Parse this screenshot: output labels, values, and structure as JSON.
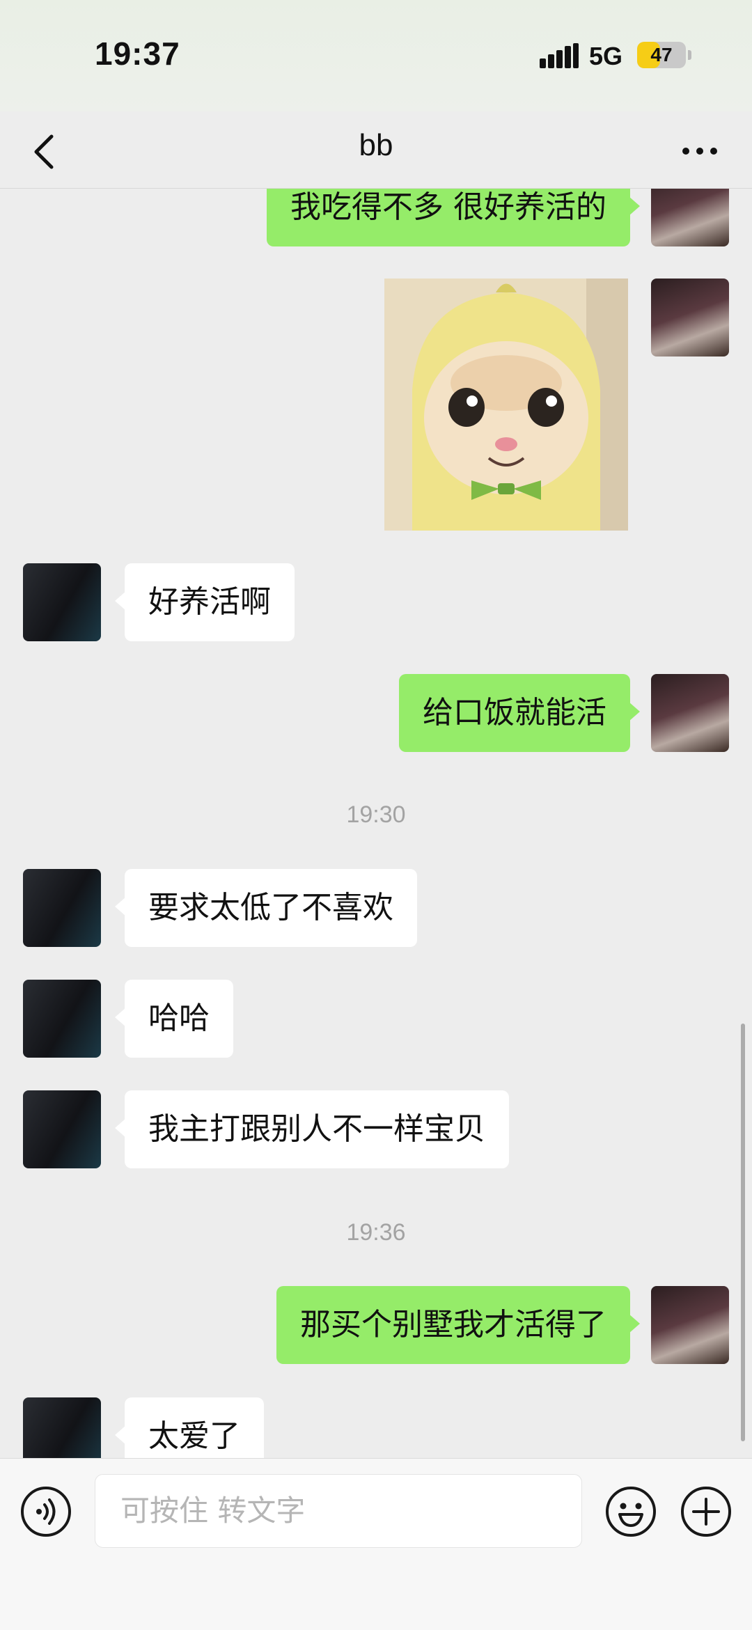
{
  "status_bar": {
    "time": "19:37",
    "network": "5G",
    "battery_level": "47",
    "battery_fraction": 0.47,
    "battery_color": "#f6cd16"
  },
  "nav": {
    "title": "bb",
    "back_icon": "chevron-left-icon",
    "more_icon": "more-dots-icon"
  },
  "colors": {
    "self_bubble": "#95ec69",
    "other_bubble": "#ffffff",
    "background": "#ededed"
  },
  "messages": [
    {
      "from": "self",
      "type": "text",
      "text": "我吃得不多 很好养活的"
    },
    {
      "from": "self",
      "type": "image",
      "description_icon": "cat-sticker-image"
    },
    {
      "from": "other",
      "type": "text",
      "text": "好养活啊"
    },
    {
      "from": "self",
      "type": "text",
      "text": "给口饭就能活"
    },
    {
      "type": "time",
      "text": "19:30"
    },
    {
      "from": "other",
      "type": "text",
      "text": "要求太低了不喜欢"
    },
    {
      "from": "other",
      "type": "text",
      "text": "哈哈"
    },
    {
      "from": "other",
      "type": "text",
      "text": "我主打跟别人不一样宝贝"
    },
    {
      "type": "time",
      "text": "19:36"
    },
    {
      "from": "self",
      "type": "text",
      "text": "那买个别墅我才活得了"
    },
    {
      "from": "other",
      "type": "text",
      "text": "太爱了"
    }
  ],
  "input_bar": {
    "placeholder": "可按住 转文字",
    "voice_icon": "voice-icon",
    "emoji_icon": "emoji-icon",
    "plus_icon": "plus-icon"
  }
}
